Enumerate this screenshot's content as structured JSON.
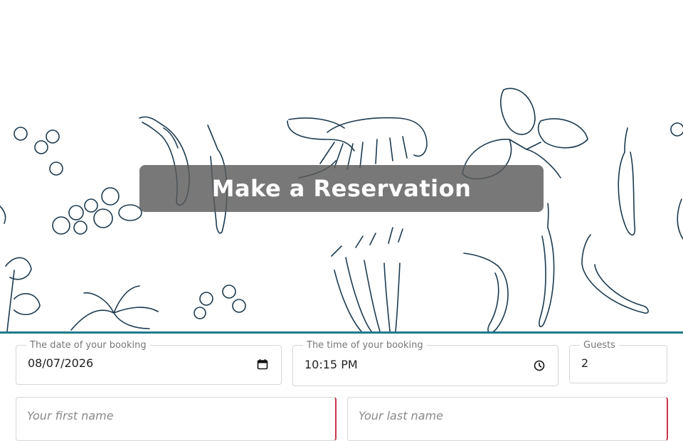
{
  "header": {
    "title": "Make a Reservation"
  },
  "form": {
    "date": {
      "label": "The date of your booking",
      "value": "08/07/2026"
    },
    "time": {
      "label": "The time of your booking",
      "value": "10:15 PM"
    },
    "guests": {
      "label": "Guests",
      "value": "2"
    },
    "first_name": {
      "placeholder": "Your first name"
    },
    "last_name": {
      "placeholder": "Your last name"
    }
  },
  "icons": {
    "date": "calendar-icon",
    "time": "clock-icon"
  },
  "colors": {
    "accent": "#1f7a8c",
    "title_bg": "#5a5a5a",
    "required": "#c8364b",
    "sketch": "#1d3a4f"
  }
}
